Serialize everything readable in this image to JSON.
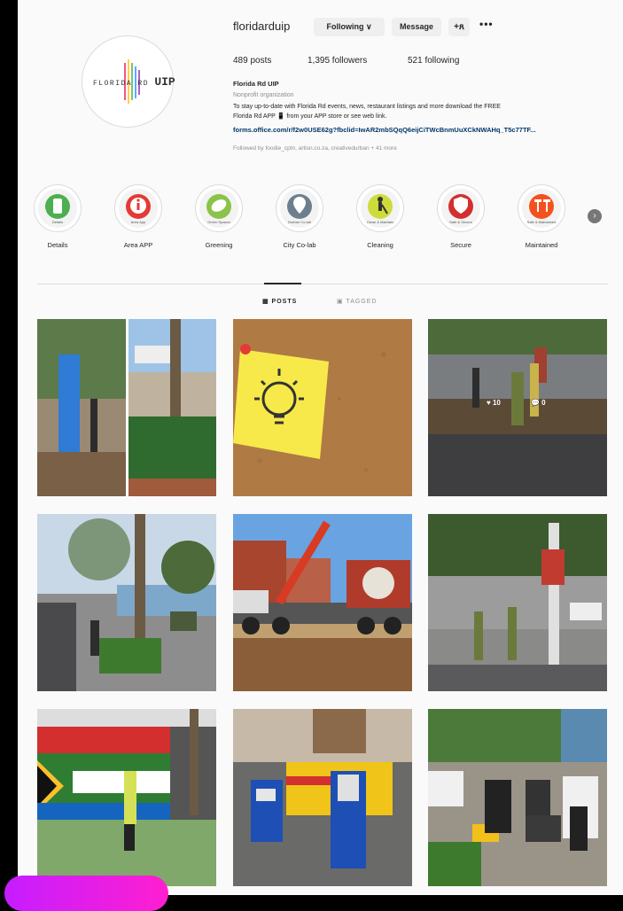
{
  "profile": {
    "username": "floridarduip",
    "logo_text": "FLORIDA RD",
    "logo_uip": "UIP",
    "buttons": {
      "following": "Following ∨",
      "message": "Message",
      "add_user": "+ጸ",
      "more": "•••"
    },
    "stats": {
      "posts": "489 posts",
      "followers": "1,395 followers",
      "following": "521 following"
    },
    "bio": {
      "name": "Florida Rd UIP",
      "category": "Nonprofit organization",
      "line1": "To stay up-to-date with Florida Rd events, news, restaurant listings and more download the FREE",
      "line2": "Florida Rd APP 📱 from your APP store or see web link.",
      "link": "forms.office.com/r/f2w0USE62g?fbclid=IwAR2mbSQqQ6eijCiTWcBnmUuXCkNWAHq_T5c77TF...",
      "followed_by": "Followed by foodie_cptn, artisn.co.za, creativedurban + 41 more"
    }
  },
  "highlights": [
    {
      "label": "Details",
      "inner": "Details",
      "color": "#4caf50",
      "icon": "phone-icon"
    },
    {
      "label": "Area APP",
      "inner": "Area App",
      "color": "#e53935",
      "icon": "info-icon"
    },
    {
      "label": "Greening",
      "inner": "Green Spaces",
      "color": "#8bc34a",
      "icon": "leaf-icon"
    },
    {
      "label": "City Co-lab",
      "inner": "Durban Co-lab",
      "color": "#6d7f8f",
      "icon": "pin-icon"
    },
    {
      "label": "Cleaning",
      "inner": "Clean & Maintain",
      "color": "#cddc39",
      "icon": "sweeper-icon"
    },
    {
      "label": "Secure",
      "inner": "Safe & Secure",
      "color": "#d32f2f",
      "icon": "shield-icon"
    },
    {
      "label": "Maintained",
      "inner": "Safe & Maintained",
      "color": "#f4511e",
      "icon": "tools-icon"
    }
  ],
  "tabs": {
    "posts": "▦ POSTS",
    "tagged": "▣ TAGGED"
  },
  "badges": {
    "likes": "♥ 10",
    "comments": "💬 0"
  },
  "colors": {
    "link": "#00376b",
    "muted": "#8e8e8e",
    "promo_start": "#c51dff",
    "promo_end": "#ff1fd0"
  }
}
